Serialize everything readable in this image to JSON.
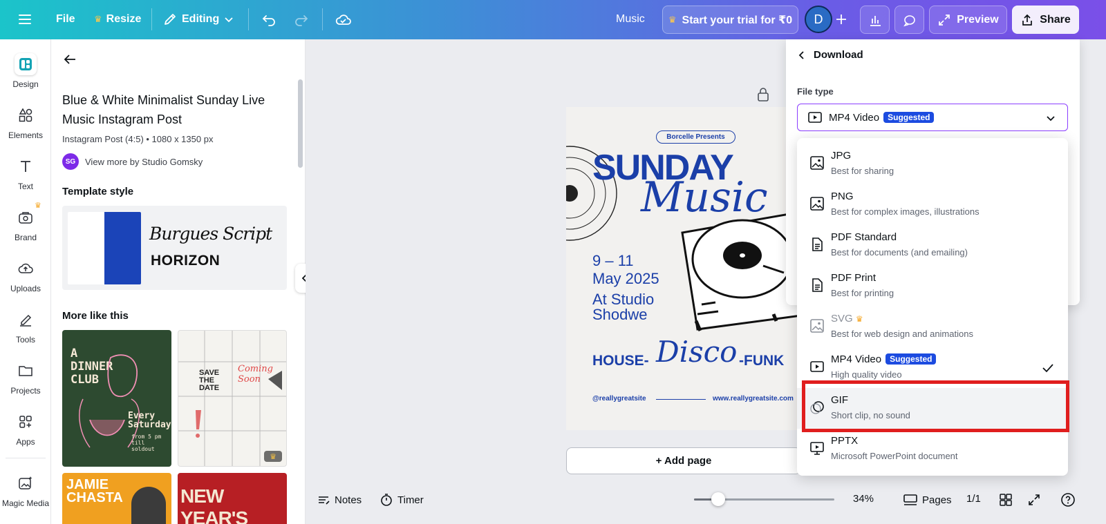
{
  "topbar": {
    "menu_icon": "hamburger-icon",
    "file_label": "File",
    "resize_label": "Resize",
    "editing_label": "Editing",
    "doc_title": "Music",
    "trial_label": "Start your trial for ₹0",
    "avatar_letter": "D",
    "preview_label": "Preview",
    "share_label": "Share"
  },
  "rail": {
    "items": [
      {
        "label": "Design"
      },
      {
        "label": "Elements"
      },
      {
        "label": "Text"
      },
      {
        "label": "Brand"
      },
      {
        "label": "Uploads"
      },
      {
        "label": "Tools"
      },
      {
        "label": "Projects"
      },
      {
        "label": "Apps"
      },
      {
        "label": "Magic Media"
      }
    ]
  },
  "panel": {
    "title": "Blue & White Minimalist Sunday Live Music Instagram Post",
    "meta": "Instagram Post (4:5) • 1080 x 1350 px",
    "author_initials": "SG",
    "author_link": "View more by Studio Gomsky",
    "template_style_heading": "Template style",
    "font_script": "Burgues Script",
    "font_display": "HORIZON",
    "more_heading": "More like this",
    "thumb1_title": "A DINNER CLUB",
    "thumb1_sub": "Every Saturday",
    "thumb1_time": "from 5 pm till soldout",
    "thumb2_title": "SAVE THE DATE",
    "thumb2_script": "Coming Soon",
    "thumb3_title": "JAMIE CHASTA",
    "thumb4_title": "NEW YEAR'S"
  },
  "poster": {
    "presenter": "Borcelle Presents",
    "title_main": "SUNDAY",
    "title_script": "Music",
    "dates_line1": "9 – 11",
    "dates_line2": "May 2025",
    "venue_line1": "At Studio",
    "venue_line2": "Shodwe",
    "genre_left": "HOUSE-",
    "genre_script": "Disco",
    "genre_right": "-FUNK",
    "handle": "@reallygreatsite",
    "website": "www.reallygreatsite.com"
  },
  "canvas": {
    "add_page_label": "+ Add page"
  },
  "bottombar": {
    "notes_label": "Notes",
    "timer_label": "Timer",
    "zoom_level": 34,
    "zoom_label": "34%",
    "pages_label": "Pages",
    "page_count": "1/1"
  },
  "download": {
    "back_label": "Download",
    "file_type_label": "File type",
    "selected_type": "MP4 Video",
    "selected_badge": "Suggested",
    "options": [
      {
        "name": "JPG",
        "desc": "Best for sharing",
        "icon": "image-icon"
      },
      {
        "name": "PNG",
        "desc": "Best for complex images, illustrations",
        "icon": "image-icon"
      },
      {
        "name": "PDF Standard",
        "desc": "Best for documents (and emailing)",
        "icon": "document-icon"
      },
      {
        "name": "PDF Print",
        "desc": "Best for printing",
        "icon": "document-icon"
      },
      {
        "name": "SVG",
        "desc": "Best for web design and animations",
        "icon": "image-icon"
      },
      {
        "name": "MP4 Video",
        "desc": "High quality video",
        "icon": "video-icon",
        "badge": "Suggested"
      },
      {
        "name": "GIF",
        "desc": "Short clip, no sound",
        "icon": "gif-icon"
      },
      {
        "name": "PPTX",
        "desc": "Microsoft PowerPoint document",
        "icon": "presentation-icon"
      }
    ]
  },
  "colors": {
    "accent": "#7d2ae8",
    "badge": "#1c4be0",
    "highlight": "#e01e1e",
    "poster_blue": "#1b3fa8"
  }
}
